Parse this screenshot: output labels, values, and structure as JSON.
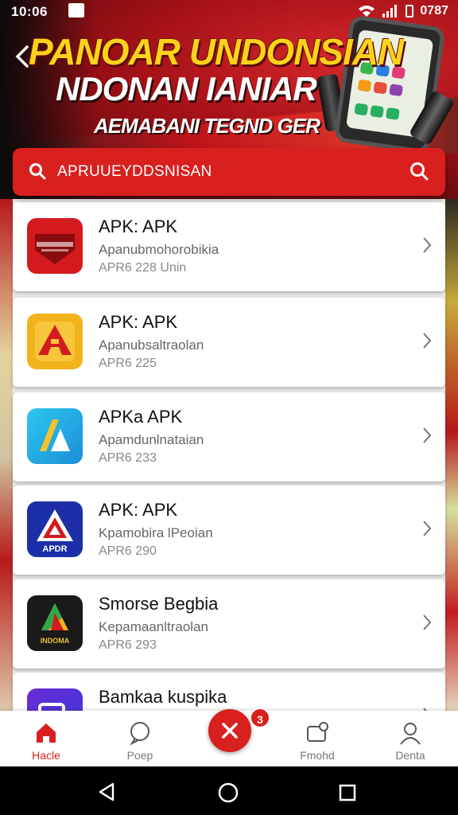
{
  "status_bar": {
    "time": "10:06",
    "right_text": "0787"
  },
  "banner": {
    "title_line1": "PANOAR UNDONSIAN",
    "title_line2": "NDONAN IANIAR",
    "subtitle": "AEMABANI TEGND GER"
  },
  "search": {
    "placeholder": "APRUUEYDDSNISAN"
  },
  "apps": [
    {
      "name": "APK: APK",
      "subtitle": "Apanubmohorobikia",
      "meta": "APR6 228 Unin"
    },
    {
      "name": "APK: APK",
      "subtitle": "Apanubsaltraolan",
      "meta": "APR6 225"
    },
    {
      "name": "APKa APK",
      "subtitle": "Apamdunlnataian",
      "meta": "APR6 233"
    },
    {
      "name": "APK: APK",
      "subtitle": "Kpamobira lPeoian",
      "meta": "APR6 290"
    },
    {
      "name": "Smorse Begbia",
      "subtitle": "Kepamaanltraolan",
      "meta": "APR6 293"
    },
    {
      "name": "Bamkaa kuspika",
      "subtitle": "",
      "meta": ""
    }
  ],
  "icon_badges": {
    "app4": "APDR",
    "app5": "INDOMA"
  },
  "bottom_nav": {
    "items": [
      {
        "label": "Hacle",
        "icon": "home-icon",
        "active": true
      },
      {
        "label": "Poep",
        "icon": "chat-icon",
        "active": false
      },
      {
        "label": "Fmohd",
        "icon": "message-icon",
        "active": false
      },
      {
        "label": "Denta",
        "icon": "profile-icon",
        "active": false
      }
    ],
    "fab_icon": "close-icon",
    "badge_count": "3"
  },
  "colors": {
    "accent": "#d8201f",
    "banner_yellow": "#ffd21a"
  }
}
